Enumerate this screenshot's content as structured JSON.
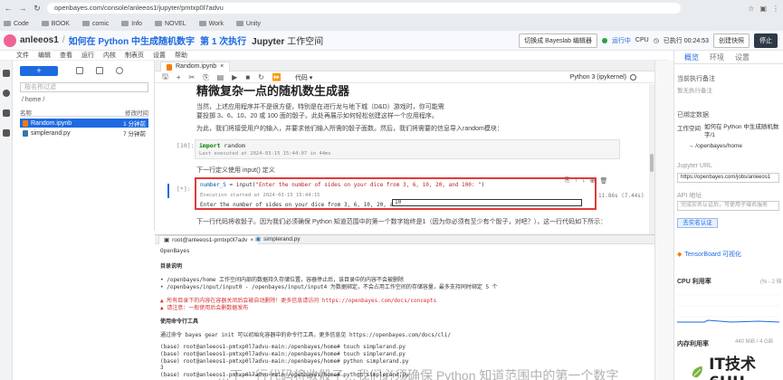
{
  "browser": {
    "url": "openbayes.com/console/anleeos1/jupyter/pmtxp0l7advu",
    "bookmarks": [
      "Code",
      "BOOK",
      "comic",
      "Info",
      "NOVEL",
      "Work",
      "Unity"
    ]
  },
  "header": {
    "user": "anleeos1",
    "project": "如何在 Python 中生成随机数字",
    "execution": "第 1 次执行",
    "workspace_jupyter": "Jupyter",
    "workspace_suffix": "工作空间",
    "switch_button": "切换成 Bayeslab 编辑器",
    "status": "运行中",
    "cpu_label": "CPU",
    "runtime": "已执行 00:24:53",
    "create_snapshot": "创建快照",
    "stop": "停止"
  },
  "menu": [
    "文件",
    "编辑",
    "查看",
    "运行",
    "内核",
    "制表页",
    "设置",
    "帮助"
  ],
  "filebrowser": {
    "new_label": "+",
    "search_placeholder": "按名称过滤",
    "path": "/ home /",
    "col_name": "名称",
    "col_modified": "修改时间",
    "files": [
      {
        "name": "Random.ipynb",
        "modified": "1 分钟前",
        "selected": true
      },
      {
        "name": "simplerand.py",
        "modified": "7 分钟前",
        "selected": false
      }
    ]
  },
  "notebook": {
    "tab_label": "Random.ipynb",
    "cell_type": "代码",
    "kernel": "Python 3 (ipykernel)",
    "heading": "精微复杂一点的随机数生成器",
    "para1": "当然，上述应用程序并不是很方便，特别是在进行龙与地下城（D&D）游戏时，你可能需要投掷 3、6、10、20 或 100 面的骰子。此处再展示如何轻松创建这样一个应用程序。",
    "para2": "为此，我们将接受用户的输入，并要求他们输入所需的骰子面数。然后，我们将需要的信息导入random模块：",
    "prompt1": "[10]:",
    "code1_kw": "import",
    "code1_rest": " random",
    "exec1": "Last executed at 2024-03-15 15:44:07 in 44ms",
    "para3": "下一行定义使用 input() 定义",
    "prompt2": "[*]:",
    "code2_var": "number_S",
    "code2_rest": " = input(",
    "code2_str": "\"Enter the number of sides on your dice from 3, 6, 10, 20, and 100: \"",
    "code2_end": ")",
    "exec2": "Execution started at 2024-03-15 15:44:15",
    "stdin_prompt": "Enter the number of sides on your dice from 3, 6, 10, 20, and 100:",
    "stdin_value": "10",
    "elapsed": "11.86s (7.44s)",
    "para4": "下一行代码将收骰子。因为我们必须确保 Python 知道范围中的第一个数字始终是1（因为你必须有至少有个骰子，对吧？），这一行代码如下所示："
  },
  "terminal": {
    "tab1": "root@anleeos1-pmtxp0l7adv",
    "tab2": "simplerand.py",
    "lines": [
      {
        "t": "OpenBayes",
        "c": ""
      },
      {
        "t": "",
        "c": ""
      },
      {
        "t": "目录说明",
        "c": "bold"
      },
      {
        "t": "",
        "c": ""
      },
      {
        "t": "• /openbayes/home 工作空间内部的数据持久存储位置，容器停止后，该目录中的内容不会被删除",
        "c": ""
      },
      {
        "t": "• /openbayes/input/input0 - /openbayes/input/input4 为数据绑定，不会占用工作空间的存储容量，最多支持同时绑定 5 个",
        "c": ""
      },
      {
        "t": "",
        "c": ""
      },
      {
        "t": "▲ 所有目录下的内容在容器关闭后会被自动删除！更多信息请访问 https://openbayes.com/docs/concepts",
        "c": "red"
      },
      {
        "t": "▲ 请注意：一般使用后会删数据发布",
        "c": "red"
      },
      {
        "t": "",
        "c": ""
      },
      {
        "t": "使用命令行工具",
        "c": "bold"
      },
      {
        "t": "",
        "c": ""
      },
      {
        "t": "通过命令 bayes gear init 可以初始化容器中的命令行工具，更多信息见 https://openbayes.com/docs/cli/",
        "c": ""
      },
      {
        "t": "",
        "c": ""
      },
      {
        "t": "(base) root@anleeos1-pmtxp0l7advu-main:/openbayes/home# touch simplerand.py",
        "c": ""
      },
      {
        "t": "(base) root@anleeos1-pmtxp0l7advu-main:/openbayes/home# touch simplerand.py",
        "c": ""
      },
      {
        "t": "(base) root@anleeos1-pmtxp0l7advu-main:/openbayes/home# python simplerand.py",
        "c": ""
      },
      {
        "t": "3",
        "c": ""
      },
      {
        "t": "(base) root@anleeos1-pmtxp0l7advu-main:/openbayes/home# python simplerand.py",
        "c": ""
      }
    ]
  },
  "rightpanel": {
    "tabs": [
      "概览",
      "环境",
      "设置"
    ],
    "current_note_label": "当前执行备注",
    "current_note_placeholder": "暂无执行备注",
    "bound_data_label": "已绑定数据",
    "workspace_item": "工作空间",
    "workspace_desc": "如何在 Python 中生成随机数字/1",
    "workspace_path": "→ /openbayes/home",
    "jupyter_url_label": "Jupyter URL",
    "jupyter_url": "https://openbayes.com/jobs/anleeos1",
    "api_label": "API 地址",
    "api_desc": "完成实名认证后，可使用子域名服务",
    "auth_button": "去实名认证",
    "tensorboard": "TensorBoard 可视化",
    "cpu_usage_label": "CPU 利用率",
    "cpu_usage_value": "(% - 2 核",
    "mem_label": "内存利用率",
    "mem_value": "440 MiB / 4 GiB"
  },
  "watermark": "IT技术6HU",
  "subtitle_overlay": "…下一行代码将收骰子…我们必须确保 Python 知道范围中的第一个数字"
}
